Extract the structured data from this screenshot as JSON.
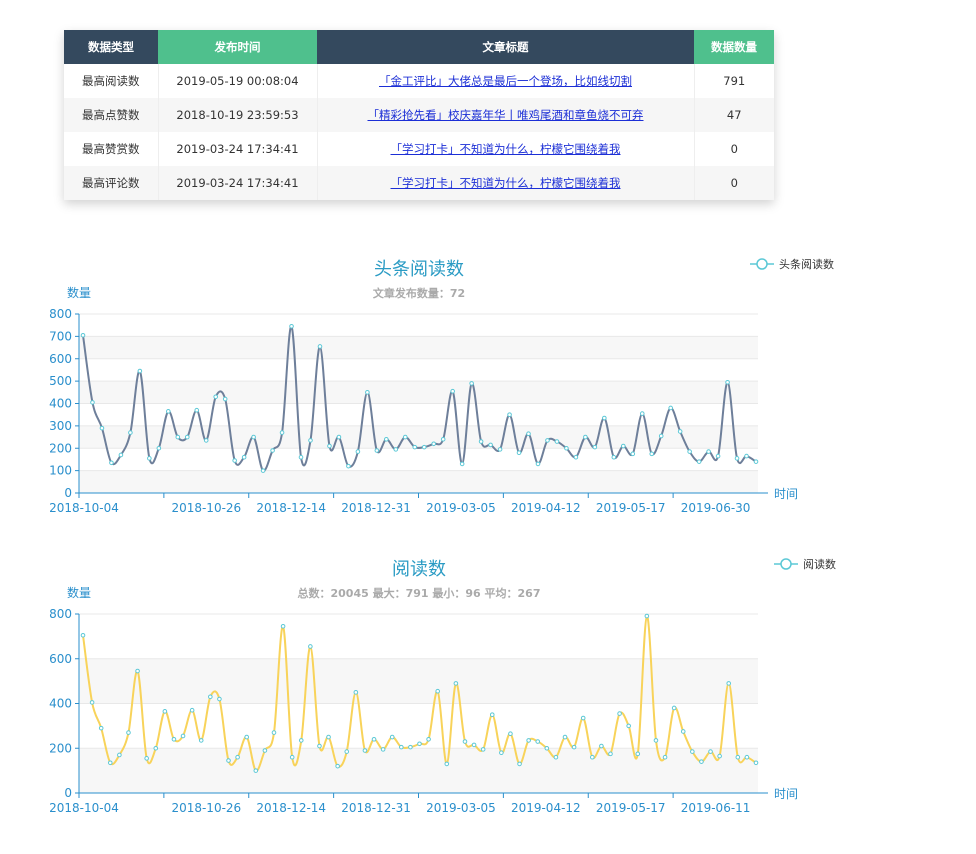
{
  "table": {
    "headers": [
      "数据类型",
      "发布时间",
      "文章标题",
      "数据数量"
    ],
    "rows": [
      {
        "type": "最高阅读数",
        "time": "2019-05-19 00:08:04",
        "title": "「金工评比」大佬总是最后一个登场，比如线切割",
        "count": "791"
      },
      {
        "type": "最高点赞数",
        "time": "2018-10-19 23:59:53",
        "title": "「精彩抢先看」校庆嘉年华丨唯鸡尾酒和章鱼烧不可弃",
        "count": "47"
      },
      {
        "type": "最高赞赏数",
        "time": "2019-03-24 17:34:41",
        "title": "「学习打卡」不知道为什么，柠檬它围绕着我",
        "count": "0"
      },
      {
        "type": "最高评论数",
        "time": "2019-03-24 17:34:41",
        "title": "「学习打卡」不知道为什么，柠檬它围绕着我",
        "count": "0"
      }
    ]
  },
  "chart_data": [
    {
      "type": "line",
      "title": "头条阅读数",
      "subtitle": "文章发布数量：72",
      "ylabel": "数量",
      "xlabel": "时间",
      "legend": "头条阅读数",
      "legend_position": "top-right",
      "ylim": [
        0,
        800
      ],
      "yticks": [
        0,
        100,
        200,
        300,
        400,
        500,
        600,
        700,
        800
      ],
      "xtick_labels": [
        "2018-10-04",
        "2018-10-26",
        "2018-12-14",
        "2018-12-31",
        "2019-03-05",
        "2019-04-12",
        "2019-05-17",
        "2019-06-30"
      ],
      "line_color": "#6e7f9a",
      "point_color": "#5bc8d6",
      "grid": true,
      "values": [
        705,
        405,
        290,
        135,
        170,
        270,
        545,
        155,
        200,
        365,
        250,
        250,
        370,
        235,
        430,
        420,
        145,
        160,
        250,
        100,
        190,
        270,
        745,
        160,
        235,
        655,
        210,
        250,
        120,
        185,
        450,
        190,
        240,
        195,
        250,
        205,
        205,
        220,
        240,
        455,
        130,
        490,
        230,
        215,
        195,
        350,
        180,
        265,
        130,
        235,
        230,
        200,
        160,
        250,
        205,
        335,
        160,
        210,
        175,
        355,
        175,
        255,
        380,
        275,
        185,
        140,
        185,
        165,
        495,
        155,
        165,
        140
      ]
    },
    {
      "type": "line",
      "title": "阅读数",
      "subtitle": "总数：20045 最大：791 最小：96 平均：267",
      "ylabel": "数量",
      "xlabel": "时间",
      "legend": "阅读数",
      "legend_position": "top-right",
      "ylim": [
        0,
        800
      ],
      "yticks": [
        0,
        200,
        400,
        600,
        800
      ],
      "xtick_labels": [
        "2018-10-04",
        "2018-10-26",
        "2018-12-14",
        "2018-12-31",
        "2019-03-05",
        "2019-04-12",
        "2019-05-17",
        "2019-06-11"
      ],
      "line_color": "#f8d35a",
      "point_color": "#5bc8d6",
      "grid": true,
      "values": [
        705,
        405,
        290,
        135,
        170,
        270,
        545,
        155,
        200,
        365,
        240,
        255,
        370,
        235,
        430,
        420,
        145,
        160,
        250,
        100,
        190,
        270,
        745,
        160,
        235,
        655,
        210,
        250,
        120,
        185,
        450,
        190,
        240,
        195,
        250,
        205,
        205,
        220,
        240,
        455,
        130,
        490,
        230,
        215,
        195,
        350,
        180,
        265,
        130,
        235,
        230,
        200,
        160,
        250,
        205,
        335,
        160,
        210,
        175,
        355,
        300,
        175,
        791,
        235,
        160,
        380,
        275,
        185,
        140,
        185,
        165,
        490,
        160,
        160,
        135
      ]
    }
  ]
}
